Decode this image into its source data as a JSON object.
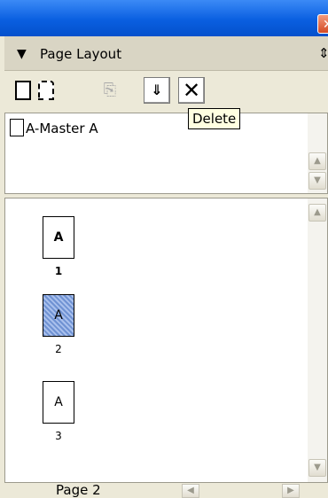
{
  "window": {
    "close_glyph": "✕"
  },
  "panel": {
    "title": "Page Layout",
    "collapse_glyph": "▼",
    "menu_glyph": "⇕"
  },
  "toolbar": {
    "delete_glyph": "✕"
  },
  "masters": {
    "items": [
      {
        "label": "A-Master A"
      }
    ]
  },
  "tooltip": {
    "text": "Delete"
  },
  "pages": [
    {
      "letter": "A",
      "number": "1",
      "selected": false
    },
    {
      "letter": "A",
      "number": "2",
      "selected": true
    },
    {
      "letter": "A",
      "number": "3",
      "selected": false
    }
  ],
  "status": {
    "current_page": "Page 2"
  },
  "colors": {
    "title_bar": "#0a5fe0",
    "selection": "#6f92d3",
    "panel_bg": "#ece9d8"
  }
}
